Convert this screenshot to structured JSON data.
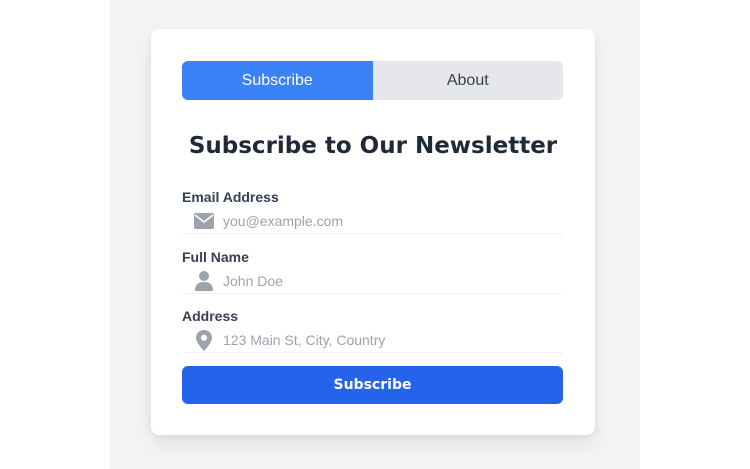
{
  "tabs": [
    {
      "label": "Subscribe",
      "active": true
    },
    {
      "label": "About",
      "active": false
    }
  ],
  "heading": "Subscribe to Our Newsletter",
  "fields": {
    "email": {
      "label": "Email Address",
      "placeholder": "you@example.com",
      "value": "",
      "icon": "envelope-icon"
    },
    "name": {
      "label": "Full Name",
      "placeholder": "John Doe",
      "value": "",
      "icon": "user-icon"
    },
    "address": {
      "label": "Address",
      "placeholder": "123 Main St, City, Country",
      "value": "",
      "icon": "map-pin-icon"
    }
  },
  "submit_label": "Subscribe",
  "colors": {
    "primary": "#3b82f6",
    "button": "#2563eb",
    "icon": "#9ca3af",
    "heading": "#1f2937"
  }
}
